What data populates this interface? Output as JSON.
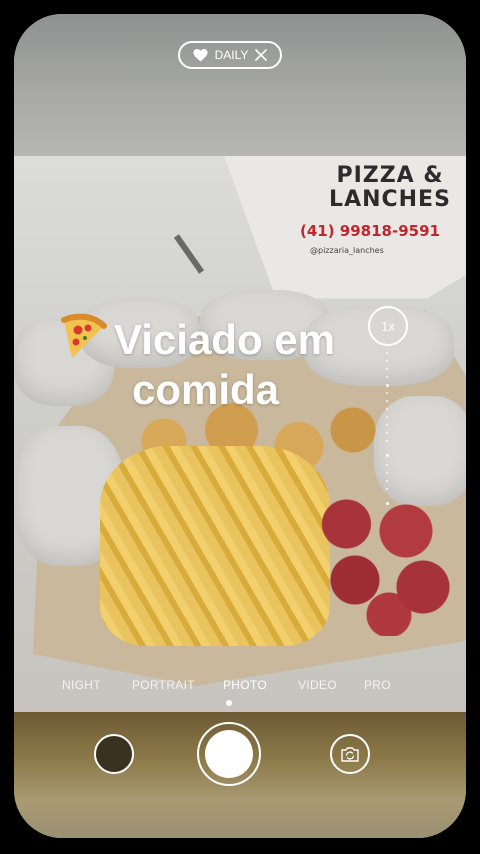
{
  "daily_pill": {
    "label": "DAILY",
    "heart_icon": "heart-icon",
    "close_icon": "close-icon"
  },
  "photo": {
    "brand_text_line1": "PIZZA &",
    "brand_text_line2": "LANCHES",
    "brand_phone": "(41) 99818-9591",
    "brand_handle": "@pizzaria_lanches"
  },
  "caption": {
    "emoji": "pizza-icon",
    "line1": "Viciado em",
    "line2": "comida"
  },
  "zoom": {
    "label": "1x"
  },
  "modes": [
    {
      "label": "NIGHT",
      "active": false
    },
    {
      "label": "PORTRAIT",
      "active": false
    },
    {
      "label": "PHOTO",
      "active": true
    },
    {
      "label": "VIDEO",
      "active": false
    },
    {
      "label": "PRO",
      "active": false
    }
  ],
  "controls": {
    "gallery_icon": "gallery-thumbnail",
    "shutter_icon": "shutter-button",
    "flip_icon": "flip-camera-icon"
  }
}
